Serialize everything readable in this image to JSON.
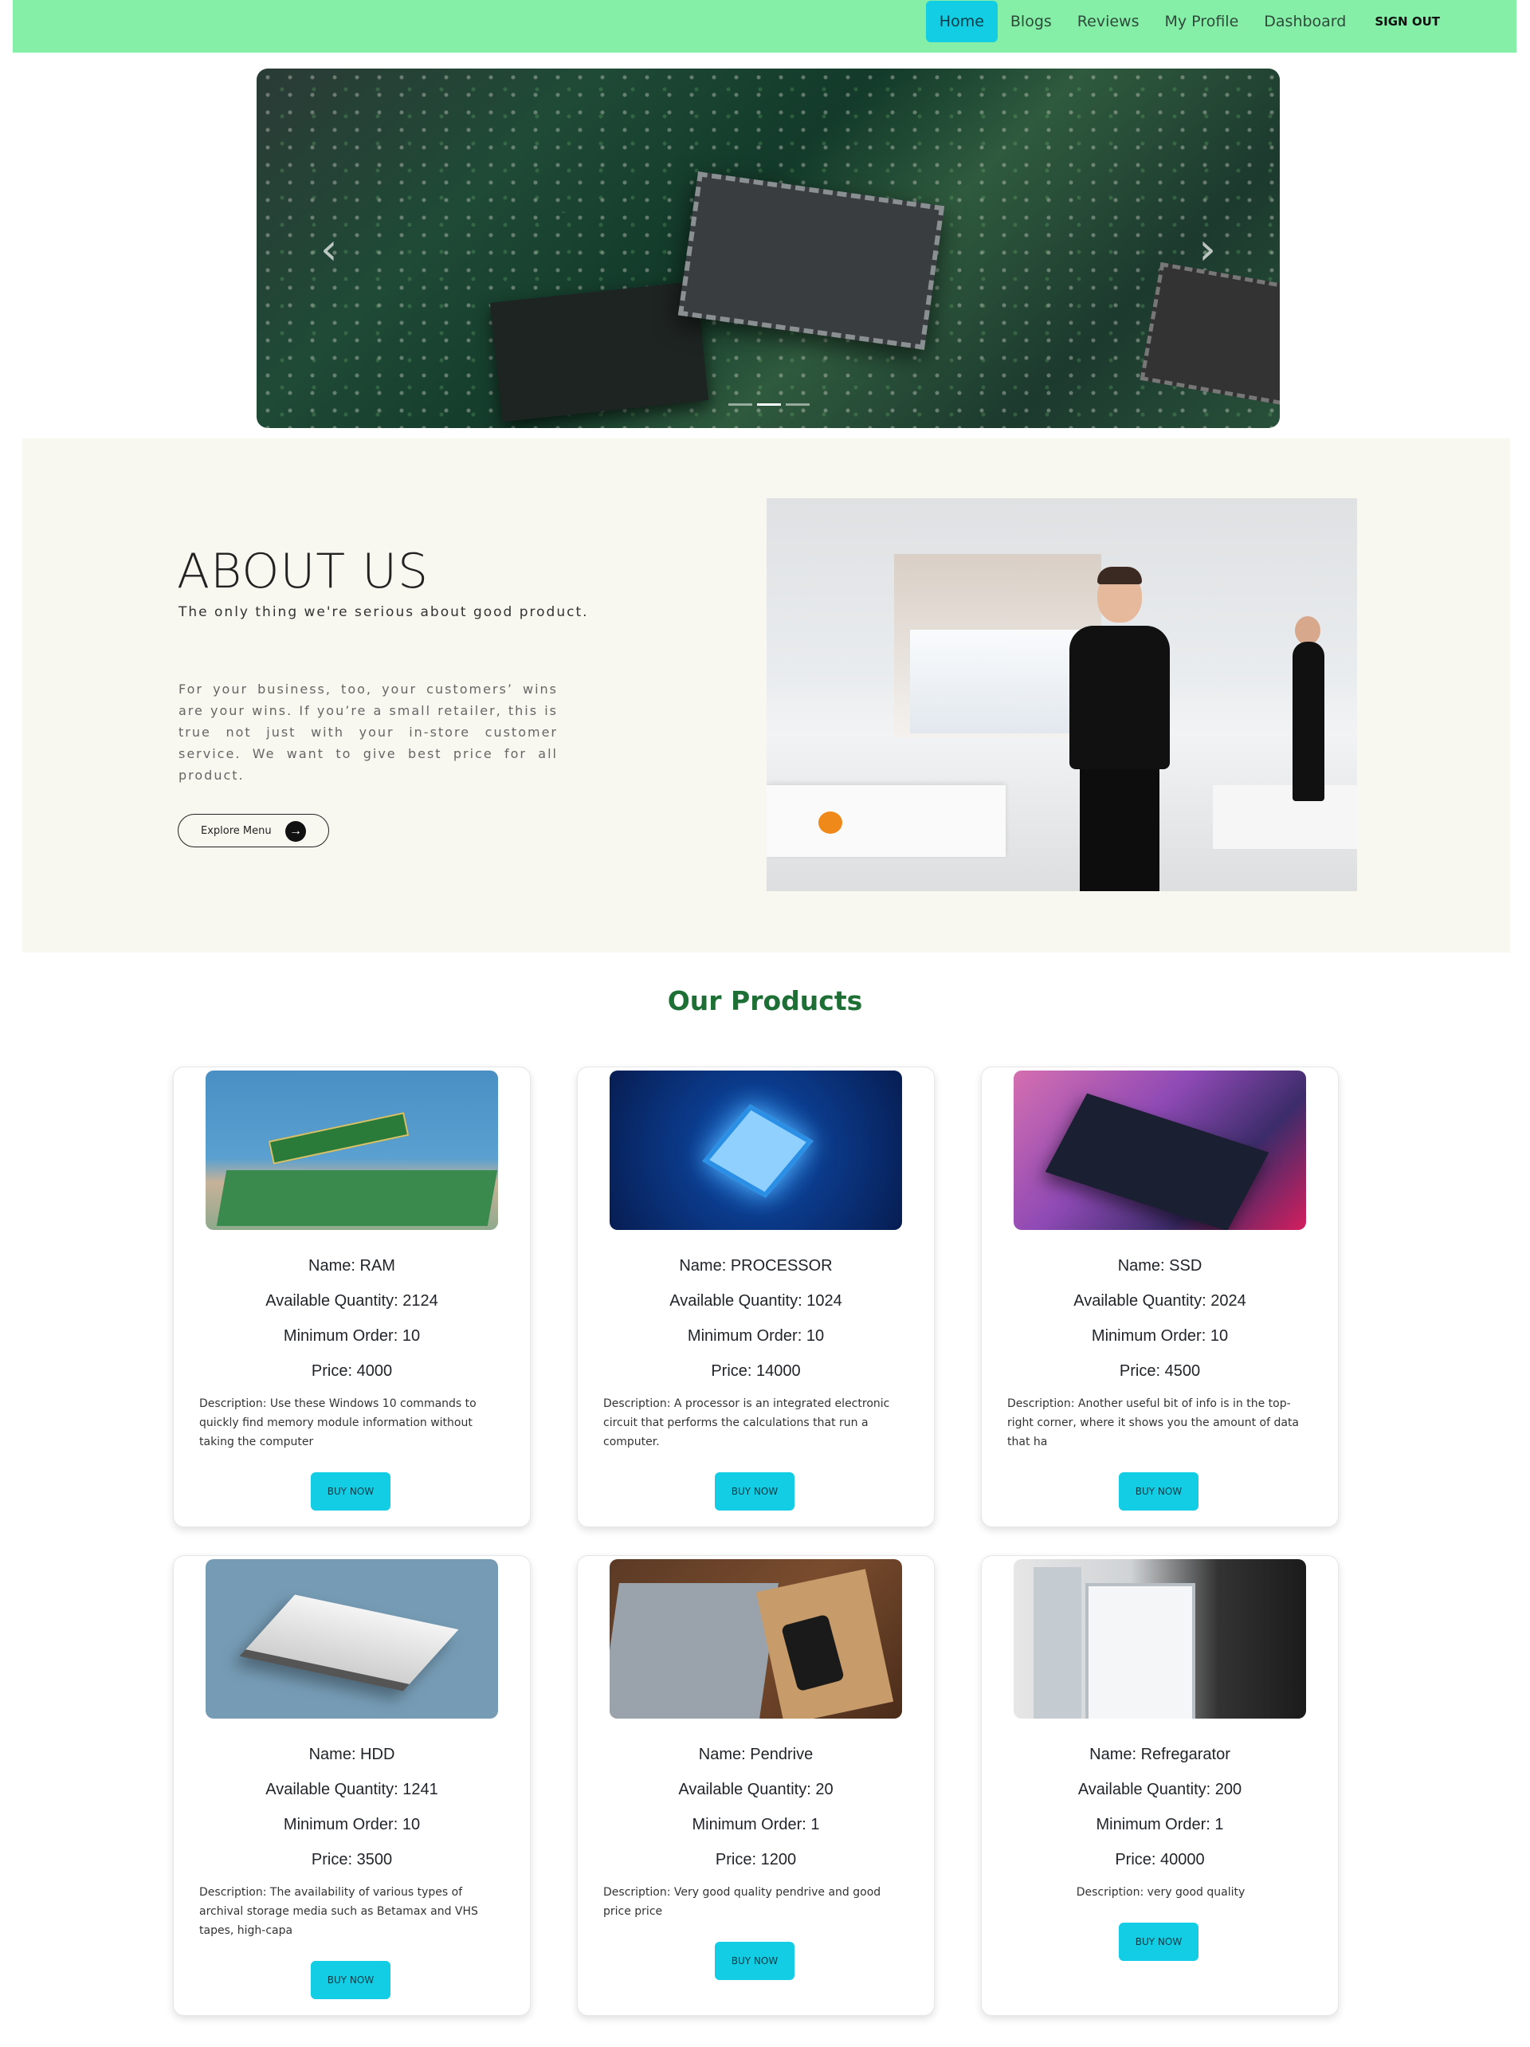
{
  "nav": {
    "links": [
      "Home",
      "Blogs",
      "Reviews",
      "My Profile",
      "Dashboard"
    ],
    "active": "Home",
    "signout_label": "SIGN OUT"
  },
  "carousel": {
    "prev_icon": "chevron-left-icon",
    "next_icon": "chevron-right-icon",
    "slide_count": 3,
    "active_slide": 2
  },
  "about": {
    "title": "ABOUT US",
    "subtitle": "The only thing we're serious about good product.",
    "body": "For your business, too, your customers’ wins are your wins. If you’re a small retailer, this is true not just with your in-store customer service. We want to give best price for all product.",
    "button_label": "Explore Menu",
    "button_icon": "arrow-right-icon"
  },
  "products": {
    "title": "Our Products",
    "buy_label": "BUY NOW",
    "items": [
      {
        "name": "Name: RAM",
        "quantity": "Available Quantity: 2124",
        "min_order": "Minimum Order: 10",
        "price": "Price: 4000",
        "description": "Description: Use these Windows 10 commands to quickly find memory module information without taking the computer"
      },
      {
        "name": "Name: PROCESSOR",
        "quantity": "Available Quantity: 1024",
        "min_order": "Minimum Order: 10",
        "price": "Price: 14000",
        "description": "Description: A processor is an integrated electronic circuit that performs the calculations that run a computer."
      },
      {
        "name": "Name: SSD",
        "quantity": "Available Quantity: 2024",
        "min_order": "Minimum Order: 10",
        "price": "Price: 4500",
        "description": "Description: Another useful bit of info is in the top-right corner, where it shows you the amount of data that ha"
      },
      {
        "name": "Name: HDD",
        "quantity": "Available Quantity: 1241",
        "min_order": "Minimum Order: 10",
        "price": "Price: 3500",
        "description": "Description: The availability of various types of archival storage media such as Betamax and VHS tapes, high-capa"
      },
      {
        "name": "Name: Pendrive",
        "quantity": "Available Quantity: 20",
        "min_order": "Minimum Order: 1",
        "price": "Price: 1200",
        "description": "Description: Very good quality pendrive and good price price"
      },
      {
        "name": "Name: Refregarator",
        "quantity": "Available Quantity: 200",
        "min_order": "Minimum Order: 1",
        "price": "Price: 40000",
        "description": "Description: very good quality"
      }
    ]
  },
  "colors": {
    "navbar_bg": "#86efa7",
    "accent": "#12cde3",
    "section_title": "#1d6f35",
    "about_bg": "#f8f8f1"
  }
}
